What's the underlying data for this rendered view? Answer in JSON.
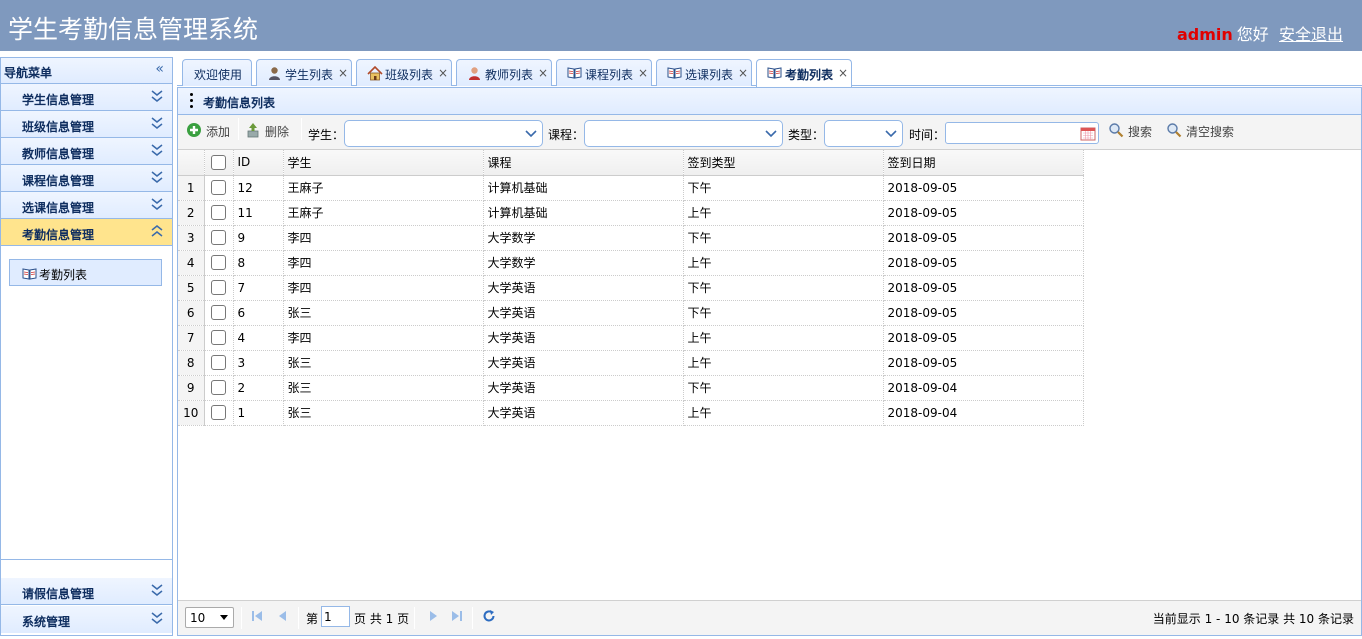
{
  "app": {
    "title": "学生考勤信息管理系统",
    "user": "admin",
    "greeting": "您好",
    "logout": "安全退出"
  },
  "sidebar": {
    "header": "导航菜单",
    "sections": [
      {
        "label": "学生信息管理"
      },
      {
        "label": "班级信息管理"
      },
      {
        "label": "教师信息管理"
      },
      {
        "label": "课程信息管理"
      },
      {
        "label": "选课信息管理"
      },
      {
        "label": "考勤信息管理"
      }
    ],
    "active_item": "考勤列表",
    "bottom_sections": [
      {
        "label": "请假信息管理"
      },
      {
        "label": "系统管理"
      }
    ]
  },
  "tabs": [
    {
      "label": "欢迎使用"
    },
    {
      "label": "学生列表",
      "icon": "user-icon"
    },
    {
      "label": "班级列表",
      "icon": "house-icon"
    },
    {
      "label": "教师列表",
      "icon": "teacher-icon"
    },
    {
      "label": "课程列表",
      "icon": "book-icon"
    },
    {
      "label": "选课列表",
      "icon": "book-icon"
    },
    {
      "label": "考勤列表",
      "icon": "book-icon"
    }
  ],
  "panel": {
    "title": "考勤信息列表"
  },
  "toolbar": {
    "add": "添加",
    "delete": "删除",
    "student_label": "学生：",
    "course_label": "课程：",
    "type_label": "类型：",
    "time_label": "时间：",
    "search": "搜索",
    "clear": "清空搜索"
  },
  "grid": {
    "columns": [
      "ID",
      "学生",
      "课程",
      "签到类型",
      "签到日期"
    ],
    "rows": [
      {
        "n": "1",
        "id": "12",
        "student": "王麻子",
        "course": "计算机基础",
        "type": "下午",
        "date": "2018-09-05"
      },
      {
        "n": "2",
        "id": "11",
        "student": "王麻子",
        "course": "计算机基础",
        "type": "上午",
        "date": "2018-09-05"
      },
      {
        "n": "3",
        "id": "9",
        "student": "李四",
        "course": "大学数学",
        "type": "下午",
        "date": "2018-09-05"
      },
      {
        "n": "4",
        "id": "8",
        "student": "李四",
        "course": "大学数学",
        "type": "上午",
        "date": "2018-09-05"
      },
      {
        "n": "5",
        "id": "7",
        "student": "李四",
        "course": "大学英语",
        "type": "下午",
        "date": "2018-09-05"
      },
      {
        "n": "6",
        "id": "6",
        "student": "张三",
        "course": "大学英语",
        "type": "下午",
        "date": "2018-09-05"
      },
      {
        "n": "7",
        "id": "4",
        "student": "李四",
        "course": "大学英语",
        "type": "上午",
        "date": "2018-09-05"
      },
      {
        "n": "8",
        "id": "3",
        "student": "张三",
        "course": "大学英语",
        "type": "上午",
        "date": "2018-09-05"
      },
      {
        "n": "9",
        "id": "2",
        "student": "张三",
        "course": "大学英语",
        "type": "下午",
        "date": "2018-09-04"
      },
      {
        "n": "10",
        "id": "1",
        "student": "张三",
        "course": "大学英语",
        "type": "上午",
        "date": "2018-09-04"
      }
    ]
  },
  "pager": {
    "page_size": "10",
    "page_prefix": "第",
    "page_value": "1",
    "page_suffix": "页 共 1 页",
    "info": "当前显示 1 - 10 条记录 共 10 条记录"
  }
}
